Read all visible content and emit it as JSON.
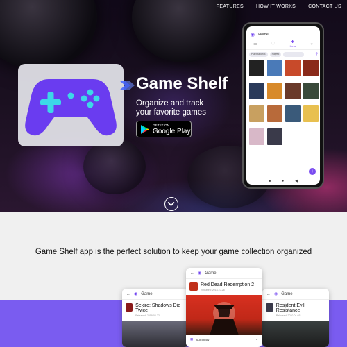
{
  "nav": {
    "items": [
      "FEATURES",
      "HOW IT WORKS",
      "CONTACT US"
    ]
  },
  "hero": {
    "title": "Game Shelf",
    "tagline": "Organize and track your favorite games",
    "store_badge": {
      "small": "GET IT ON",
      "big": "Google Play"
    }
  },
  "phone": {
    "app_title": "Home",
    "active_tab": "Home",
    "filters": [
      "PlayStation 4",
      "Played"
    ],
    "games": [
      {
        "title": "",
        "color": "#222222"
      },
      {
        "title": "",
        "color": "#4a7ab8"
      },
      {
        "title": "",
        "color": "#c84a2a"
      },
      {
        "title": "",
        "color": "#8a2a1a"
      },
      {
        "title": "",
        "color": "#2a3a5a"
      },
      {
        "title": "",
        "color": "#d88a2a"
      },
      {
        "title": "",
        "color": "#6a3a2a"
      },
      {
        "title": "",
        "color": "#3a4a3a"
      },
      {
        "title": "",
        "color": "#c8a060"
      },
      {
        "title": "",
        "color": "#b86a3a"
      },
      {
        "title": "",
        "color": "#3a5a7a"
      },
      {
        "title": "",
        "color": "#e8c050"
      },
      {
        "title": "",
        "color": "#d8b8c8"
      },
      {
        "title": "",
        "color": "#3a3a4a"
      }
    ]
  },
  "headline": "Game Shelf app is the perfect solution to keep your game collection organized",
  "cards": {
    "left": {
      "bar": "Game",
      "title": "Sekiro: Shadows Die Twice",
      "released": "Released: 2019-03-22"
    },
    "center": {
      "bar": "Game",
      "title": "Red Dead Redemption 2",
      "released": "Released: 2018-10-26",
      "summary": "Summary"
    },
    "right": {
      "bar": "Game",
      "title": "Resident Evil: Resistance",
      "released": "Released: 2020-04-03"
    }
  },
  "colors": {
    "accent": "#7a5cf0",
    "controller_purple": "#6a3cf0",
    "controller_teal": "#3cd8e8"
  }
}
